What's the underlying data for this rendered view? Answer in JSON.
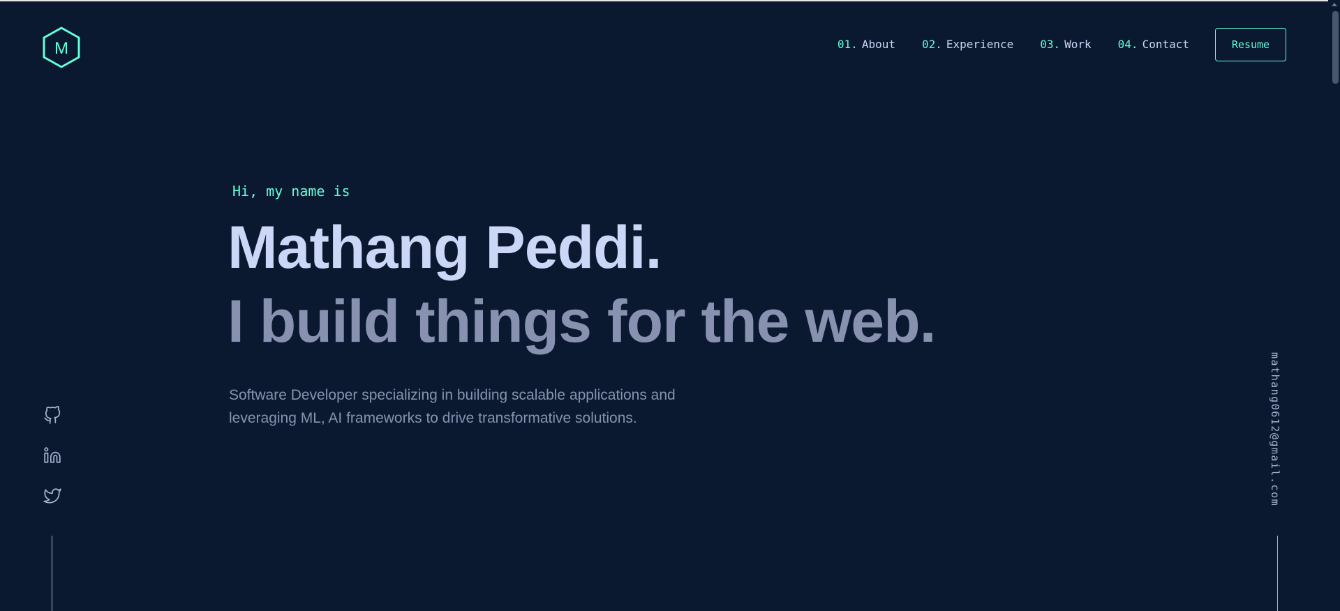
{
  "logo": {
    "letter": "M",
    "icon": "hexagon-logo-icon"
  },
  "nav": {
    "items": [
      {
        "num": "01.",
        "label": "About"
      },
      {
        "num": "02.",
        "label": "Experience"
      },
      {
        "num": "03.",
        "label": "Work"
      },
      {
        "num": "04.",
        "label": "Contact"
      }
    ],
    "resume_label": "Resume"
  },
  "hero": {
    "greeting": "Hi, my name is",
    "name": "Mathang Peddi.",
    "tagline": "I build things for the web.",
    "intro": "Software Developer specializing in building scalable applications and leveraging ML, AI frameworks to drive transformative solutions."
  },
  "social": {
    "icons": [
      "github-icon",
      "linkedin-icon",
      "twitter-icon"
    ]
  },
  "email": "mathang0612@gmail.com",
  "colors": {
    "background": "#0a192f",
    "accent": "#64ffda",
    "heading": "#ccd6f6",
    "text": "#8892b0"
  }
}
